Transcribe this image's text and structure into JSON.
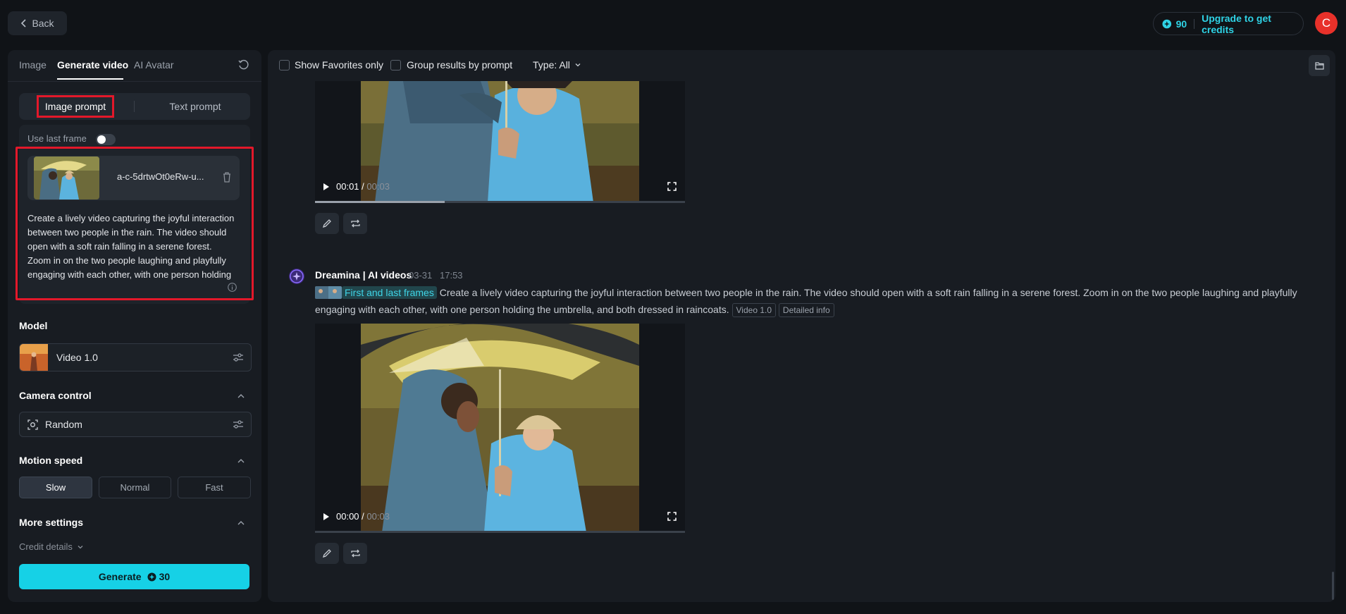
{
  "topbar": {
    "back_label": "Back",
    "credits": "90",
    "upgrade_label": "Upgrade to get credits",
    "avatar_letter": "C"
  },
  "left": {
    "tabs": [
      {
        "label": "Image"
      },
      {
        "label": "Generate video"
      },
      {
        "label": "AI Avatar"
      }
    ],
    "prompt_modes": {
      "image": "Image prompt",
      "text": "Text prompt"
    },
    "use_last_frame_label": "Use last frame",
    "file_name": "a-c-5drtwOt0eRw-u...",
    "prompt_text": "Create a lively video capturing the joyful interaction between two people in the rain. The video should open with a soft rain falling in a serene forest. Zoom in on the two people laughing and playfully engaging with each other, with one person holding the umbrella, and both dressed in raincoats.",
    "model_label": "Model",
    "model_value": "Video 1.0",
    "camera_label": "Camera control",
    "camera_value": "Random",
    "speed_label": "Motion speed",
    "speeds": [
      "Slow",
      "Normal",
      "Fast"
    ],
    "more_settings_label": "More settings",
    "credit_details_label": "Credit details",
    "generate_label": "Generate",
    "generate_cost": "30"
  },
  "right": {
    "filters": {
      "favorites": "Show Favorites only",
      "group": "Group results by prompt",
      "type": "Type: All"
    },
    "video1": {
      "current": "00:01",
      "total": "00:03"
    },
    "message": {
      "sender": "Dreamina | AI videos",
      "date": "03-31",
      "time": "17:53",
      "frames_tag": "First and last frames",
      "text": "Create a lively video capturing the joyful interaction between two people in the rain. The video should open with a soft rain falling in a serene forest. Zoom in on the two people laughing and playfully engaging with each other, with one person holding the umbrella, and both dressed in raincoats.",
      "model_tag": "Video 1.0",
      "detail_tag": "Detailed info"
    },
    "video2": {
      "current": "00:00",
      "total": "00:03"
    }
  },
  "colors": {
    "accent": "#16d1e6",
    "highlight": "#e3182a",
    "avatar": "#e8312a"
  }
}
